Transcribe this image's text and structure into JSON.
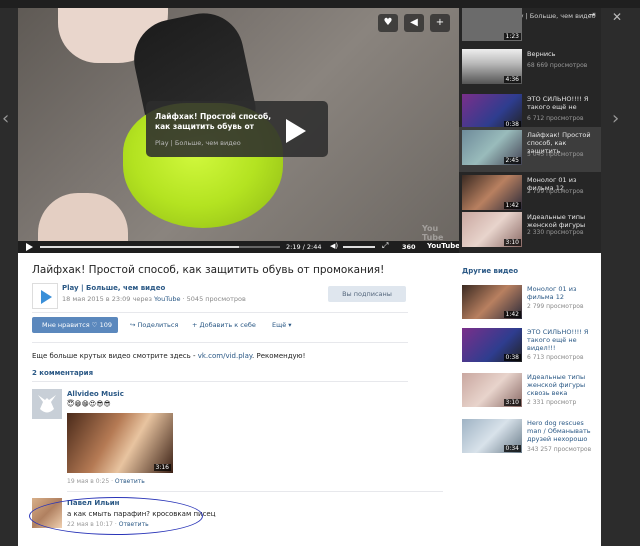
{
  "player": {
    "overlay_title": "Лайфхак! Простой способ, как защитить обувь от",
    "overlay_channel": "Play | Больше, чем видео",
    "time": "2:19 / 2:44",
    "quality": "360",
    "progress_fraction": 0.83,
    "yt_logo": "YouTube",
    "watermark": "You Tube"
  },
  "playlist": {
    "header": "Видеозаписи Play | Больше, чем видео",
    "items": [
      {
        "title": "",
        "views": "",
        "duration": "1:23"
      },
      {
        "title": "Вернись",
        "views": "68 669 просмотров",
        "duration": "4:36"
      },
      {
        "title": "ЭТО СИЛЬНО!!!! Я такого ещё не",
        "views": "6 712 просмотров",
        "duration": "0:38"
      },
      {
        "title": "Лайфхак! Простой способ, как защитить",
        "views": "5 045 просмотров",
        "duration": "2:45"
      },
      {
        "title": "Монолог 01 из фильма 12",
        "views": "2 799 просмотров",
        "duration": "1:42"
      },
      {
        "title": "Идеальные типы женской фигуры",
        "views": "2 330 просмотров",
        "duration": "3:10"
      }
    ]
  },
  "video": {
    "title": "Лайфхак! Простой способ, как защитить обувь от промокания!",
    "channel": "Play | Больше, чем видео",
    "date_prefix": "18 мая 2015 в 23:09 через",
    "source": "YouTube",
    "views": "· 5045 просмотров",
    "subscribed": "Вы подписаны",
    "like_label": "Мне нравится ♡ 109",
    "share": "Поделиться",
    "add": "Добавить к себе",
    "more": "Ещё",
    "desc_text": "Еще больше крутых видео смотрите здесь -",
    "desc_link": "vk.com/vid.play",
    "desc_tail": ". Рекомендую!",
    "comments_count": "2 комментария"
  },
  "comments": [
    {
      "author": "Allvideo Music",
      "text": "😇😁😁😍😎😎",
      "date": "19 мая в 0:25",
      "reply": "Ответить",
      "image_duration": "3:16"
    },
    {
      "author": "Павел Ильин",
      "text": "а как смыть парафин? кросовкам писец",
      "date": "22 мая в 10:17",
      "reply": "Ответить"
    }
  ],
  "other": {
    "header": "Другие видео",
    "items": [
      {
        "title": "Монолог 01 из фильма 12",
        "views": "2 799 просмотров",
        "duration": "1:42"
      },
      {
        "title": "ЭТО СИЛЬНО!!!! Я такого ещё не видел!!!",
        "views": "6 713 просмотров",
        "duration": "0:38"
      },
      {
        "title": "Идеальные типы женской фигуры сквозь века",
        "views": "2 331 просмотр",
        "duration": "3:10"
      },
      {
        "title": "Hero dog rescues man / Обманывать друзей нехорошо",
        "views": "343 257 просмотров",
        "duration": "0:34"
      }
    ]
  },
  "colors": {
    "link": "#2a5885",
    "like": "#5b88bd",
    "annotation": "#2a35b8"
  }
}
